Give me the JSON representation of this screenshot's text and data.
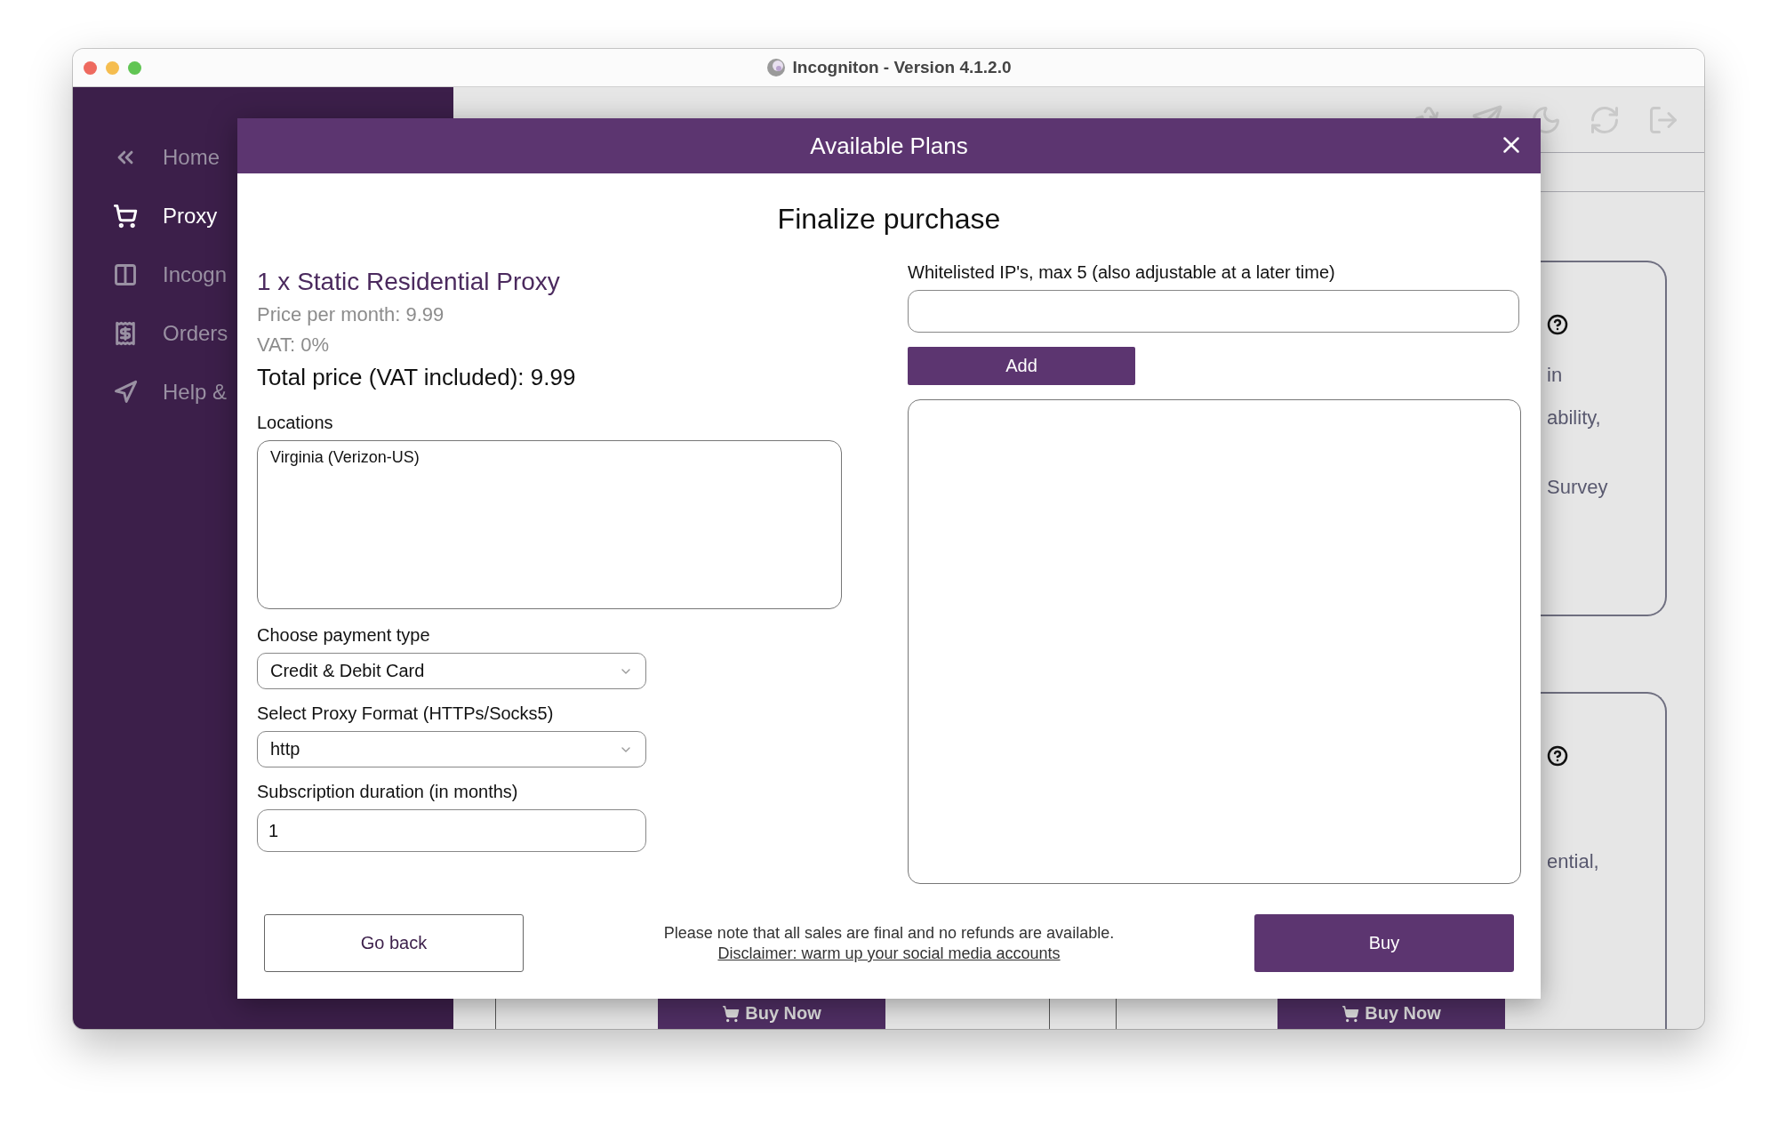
{
  "window": {
    "title": "Incogniton - Version 4.1.2.0"
  },
  "sidebar": {
    "items": [
      {
        "label": "Home",
        "selected": false
      },
      {
        "label": "Proxy",
        "selected": true
      },
      {
        "label": "Incogn",
        "selected": false
      },
      {
        "label": "Orders",
        "selected": false
      },
      {
        "label": "Help &",
        "selected": false
      }
    ]
  },
  "background": {
    "cards": [
      {
        "paragraphs": [
          [
            "in",
            "ability,"
          ],
          [
            "Survey"
          ]
        ]
      },
      {
        "paragraphs": [
          [
            "ential,"
          ]
        ]
      }
    ],
    "buy_buttons": [
      "Buy Now",
      "Buy Now"
    ]
  },
  "dialog": {
    "title": "Available Plans",
    "heading": "Finalize purchase",
    "product": "1 x Static Residential Proxy",
    "price": "Price per month: 9.99",
    "vat": "VAT: 0%",
    "total": "Total price (VAT included): 9.99",
    "locations": {
      "label": "Locations",
      "items": [
        "Virginia (Verizon-US)"
      ]
    },
    "payment": {
      "label": "Choose payment type",
      "value": "Credit & Debit Card"
    },
    "format": {
      "label": "Select Proxy Format (HTTPs/Socks5)",
      "value": "http"
    },
    "duration": {
      "label": "Subscription duration (in months)",
      "value": "1"
    },
    "whitelist": {
      "label": "Whitelisted IP's, max 5 (also adjustable at a later time)",
      "add_button": "Add"
    },
    "footer": {
      "back_button": "Go back",
      "note": "Please note that all sales are final and no refunds are available.",
      "link": "Disclaimer: warm up your social media accounts",
      "buy_button": "Buy"
    }
  }
}
